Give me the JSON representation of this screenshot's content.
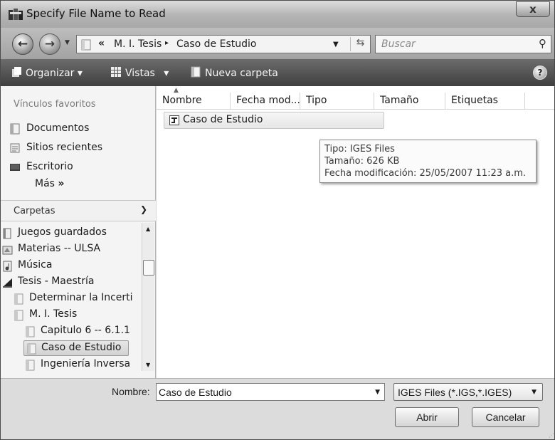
{
  "window": {
    "title": "Specify File Name to Read",
    "close_label": "x"
  },
  "address_bar": {
    "overflow": "«",
    "crumbs": [
      "M. I. Tesis",
      "Caso de Estudio"
    ],
    "separator": "▸",
    "search_placeholder": "Buscar"
  },
  "toolbar": {
    "organize": "Organizar",
    "views": "Vistas",
    "new_folder": "Nueva carpeta",
    "dropdown_glyph": "▾",
    "help": "?"
  },
  "sidebar": {
    "favorites_header": "Vínculos favoritos",
    "favorites": [
      {
        "label": "Documentos",
        "icon": "documents-icon"
      },
      {
        "label": "Sitios recientes",
        "icon": "recent-places-icon"
      },
      {
        "label": "Escritorio",
        "icon": "desktop-icon"
      }
    ],
    "more": "Más",
    "more_arrows": "»",
    "folders_header": "Carpetas",
    "tree": [
      {
        "label": "Juegos guardados",
        "icon": "saved-games-icon",
        "indent": 0
      },
      {
        "label": "Materias  --  ULSA",
        "icon": "materias-icon",
        "indent": 0
      },
      {
        "label": "Música",
        "icon": "music-icon",
        "indent": 0
      },
      {
        "label": "Tesis - Maestría",
        "icon": "tesis-icon",
        "indent": 0
      },
      {
        "label": "Determinar la Incerti",
        "icon": "folder-icon",
        "indent": 1
      },
      {
        "label": "M. I.  Tesis",
        "icon": "folder-icon",
        "indent": 1
      },
      {
        "label": "Capitulo 6  --  6.1.1",
        "icon": "folder-icon",
        "indent": 2
      },
      {
        "label": "Caso de Estudio",
        "icon": "folder-icon",
        "indent": 2,
        "selected": true
      },
      {
        "label": "Ingeniería  Inversa",
        "icon": "folder-icon",
        "indent": 2
      }
    ]
  },
  "file_list": {
    "columns": [
      "Nombre",
      "Fecha mod...",
      "Tipo",
      "Tamaño",
      "Etiquetas"
    ],
    "items": [
      {
        "name": "Caso de Estudio",
        "icon": "iges-file-icon"
      }
    ],
    "tooltip": {
      "type_line": "Tipo: IGES Files",
      "size_line": "Tamaño: 626 KB",
      "date_line": "Fecha modificación: 25/05/2007 11:23 a.m."
    }
  },
  "bottom": {
    "name_label": "Nombre:",
    "name_value": "Caso de Estudio",
    "file_type": "IGES Files (*.IGS,*.IGES)",
    "open": "Abrir",
    "cancel": "Cancelar"
  }
}
